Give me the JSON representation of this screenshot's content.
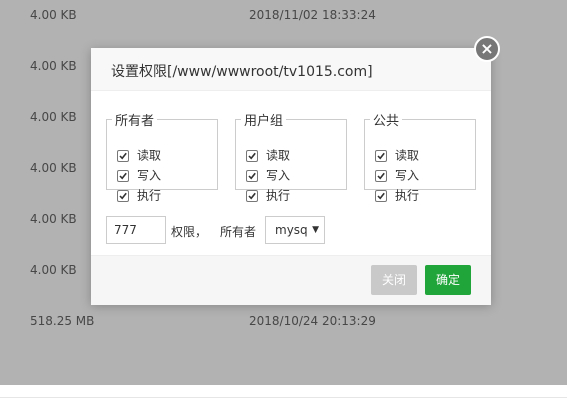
{
  "background_rows": [
    {
      "size": "4.00 KB",
      "time": "2018/11/02 18:33:24"
    },
    {
      "size": "4.00 KB",
      "time": ""
    },
    {
      "size": "4.00 KB",
      "time": ""
    },
    {
      "size": "4.00 KB",
      "time": ""
    },
    {
      "size": "4.00 KB",
      "time": ""
    },
    {
      "size": "4.00 KB",
      "time": ""
    },
    {
      "size": "518.25 MB",
      "time": "2018/10/24 20:13:29"
    }
  ],
  "dialog": {
    "title": "设置权限[/www/wwwroot/tv1015.com]",
    "close_icon": "×",
    "groups": [
      {
        "legend": "所有者",
        "items": [
          {
            "label": "读取",
            "checked": true
          },
          {
            "label": "写入",
            "checked": true
          },
          {
            "label": "执行",
            "checked": true
          }
        ]
      },
      {
        "legend": "用户组",
        "items": [
          {
            "label": "读取",
            "checked": true
          },
          {
            "label": "写入",
            "checked": true
          },
          {
            "label": "执行",
            "checked": true
          }
        ]
      },
      {
        "legend": "公共",
        "items": [
          {
            "label": "读取",
            "checked": true
          },
          {
            "label": "写入",
            "checked": true
          },
          {
            "label": "执行",
            "checked": true
          }
        ]
      }
    ],
    "permission_value": "777",
    "permission_label": "权限，",
    "owner_label": "所有者",
    "owner_value": "mysq",
    "select_arrow": "▼",
    "close_button": "关闭",
    "confirm_button": "确定"
  },
  "colors": {
    "confirm": "#20a53a",
    "close_button": "#c9c9c9",
    "close_icon": "#777777"
  }
}
